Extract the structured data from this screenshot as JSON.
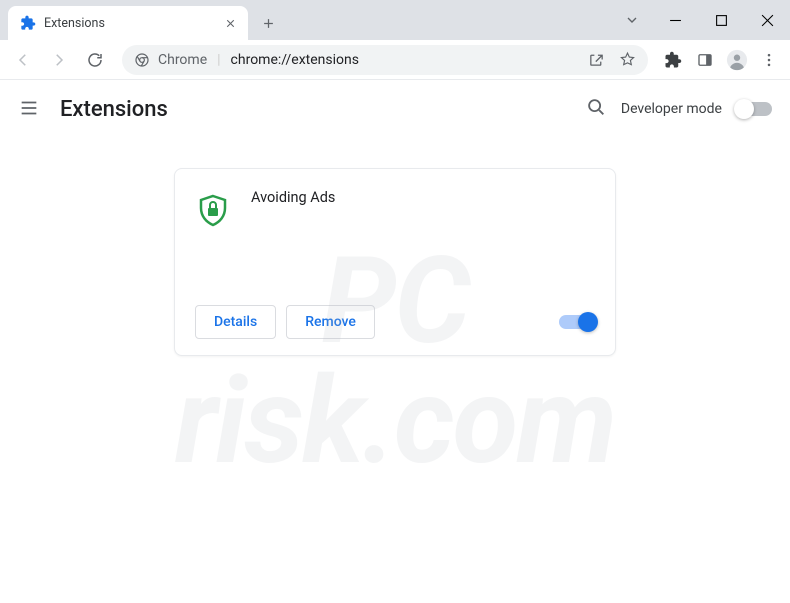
{
  "browser": {
    "tab": {
      "title": "Extensions"
    },
    "omnibox": {
      "prefix": "Chrome",
      "url": "chrome://extensions"
    }
  },
  "page": {
    "title": "Extensions",
    "dev_mode_label": "Developer mode"
  },
  "extension": {
    "name": "Avoiding Ads",
    "details_label": "Details",
    "remove_label": "Remove",
    "enabled": true
  },
  "watermark": {
    "line1": "PC",
    "line2": "risk.com"
  }
}
